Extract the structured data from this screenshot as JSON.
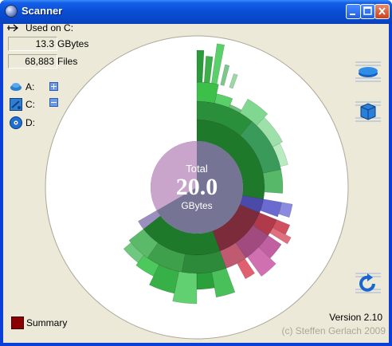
{
  "window": {
    "title": "Scanner"
  },
  "header": {
    "label": "Used on C:"
  },
  "stats": [
    {
      "value": "13.3",
      "unit": "GBytes"
    },
    {
      "value": "68,883",
      "unit": "Files"
    }
  ],
  "drives": [
    {
      "label": "A:",
      "icon": "floppy-drive-icon"
    },
    {
      "label": "C:",
      "icon": "hard-drive-icon"
    },
    {
      "label": "D:",
      "icon": "cd-drive-icon"
    }
  ],
  "center": {
    "caption": "Total",
    "value": "20.0",
    "unit": "GBytes"
  },
  "summary": {
    "label": "Summary"
  },
  "footer": {
    "version": "Version 2.10",
    "copyright": "(c) Steffen Gerlach 2009"
  },
  "colors": {
    "titlebar": "#0a4fd6",
    "window_bg": "#ece9d8",
    "used": "#757494",
    "free": "#c9a5cb",
    "green": "#1f8a2b",
    "red": "#7a2430"
  }
}
